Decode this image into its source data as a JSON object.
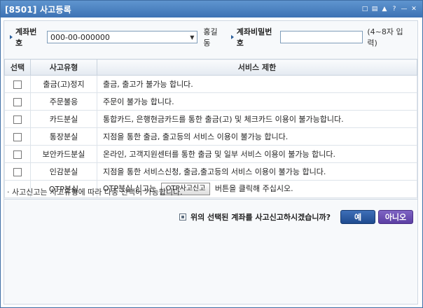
{
  "window": {
    "title": "[8501] 사고등록",
    "controls": [
      "restore-icon",
      "print-icon",
      "pin-icon",
      "help-icon",
      "minimize-icon",
      "close-icon"
    ]
  },
  "topbar": {
    "account_label": "계좌번호",
    "account_value": "000-00-000000",
    "owner_name": "홍길동",
    "password_label": "계좌비밀번호",
    "password_value": "",
    "password_hint": "(4~8자 입력)"
  },
  "table": {
    "headers": [
      "선택",
      "사고유형",
      "서비스 제한"
    ],
    "rows": [
      {
        "type": "출금(고)정지",
        "restriction": "출금, 출고가 불가능 합니다.",
        "has_checkbox": true
      },
      {
        "type": "주문불응",
        "restriction": "주문이 불가능 합니다.",
        "has_checkbox": true
      },
      {
        "type": "카드분실",
        "restriction": "통합카드, 은행현금카드를 통한 출금(고) 및 체크카드 이용이 불가능합니다.",
        "has_checkbox": true
      },
      {
        "type": "통장분실",
        "restriction": "지점을 통한 출금, 출고등의 서비스 이용이 불가능 합니다.",
        "has_checkbox": true
      },
      {
        "type": "보안카드분실",
        "restriction": "온라인, 고객지원센터를 통한 출금 및 일부 서비스 이용이 불가능 합니다.",
        "has_checkbox": true
      },
      {
        "type": "인감분실",
        "restriction": "지점을 통한 서비스신청, 출금,출고등의 서비스 이용이 불가능 합니다.",
        "has_checkbox": true
      }
    ],
    "otp_row": {
      "type": "OTP분실",
      "restriction_before": "OTP분실 신고는",
      "button_label": "OTP사고신고",
      "restriction_after": "버튼을 클릭해 주십시오."
    }
  },
  "note": "· 사고신고는 사고유형에 따라 다중 선택이 가능합니다.",
  "confirm": {
    "question": "위의 선택된 계좌를 사고신고하시겠습니까?",
    "yes_label": "예",
    "no_label": "아니오"
  },
  "colors": {
    "titlebar": "#4a80c2",
    "yes_button": "#2d5ca3",
    "no_button": "#6a4fb5"
  }
}
